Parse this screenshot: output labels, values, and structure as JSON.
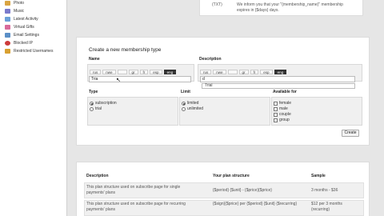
{
  "sidebar": {
    "items": [
      {
        "label": "Photo",
        "icon": "photo-icon",
        "color": "#d9a441"
      },
      {
        "label": "Music",
        "icon": "music-icon",
        "color": "#7a7acc"
      },
      {
        "label": "Latest Activity",
        "icon": "activity-icon",
        "color": "#6aa0d8"
      },
      {
        "label": "Virtual Gifts",
        "icon": "gift-icon",
        "color": "#d86a9a"
      },
      {
        "label": "Email Settings",
        "icon": "email-icon",
        "color": "#5b8fc7"
      },
      {
        "label": "Blocked IP",
        "icon": "blocked-icon",
        "color": "#cc3b3b"
      },
      {
        "label": "Restricted Usernames",
        "icon": "restricted-icon",
        "color": "#d8a030"
      }
    ]
  },
  "top_panel": {
    "code": "(TXT)",
    "note": "We inform you that your \"{membership_name}\" membership expires in {$days} days."
  },
  "form": {
    "heading": "Create a new membership type",
    "name_label": "Name",
    "description_label": "Description",
    "languages": [
      "rus",
      "nwe",
      "",
      "gr",
      "fr",
      "esp",
      "eng"
    ],
    "active_language": "eng",
    "name_value": "Tria",
    "description_value": "d",
    "dropdown_value": "Trial",
    "type_label": "Type",
    "limit_label": "Limit",
    "available_label": "Available for",
    "type_options": [
      {
        "label": "subscription",
        "selected": true
      },
      {
        "label": "trial",
        "selected": false
      }
    ],
    "limit_options": [
      {
        "label": "limited",
        "selected": true
      },
      {
        "label": "unlimited",
        "selected": false
      }
    ],
    "available_options": [
      {
        "label": "female",
        "checked": false
      },
      {
        "label": "male",
        "checked": false
      },
      {
        "label": "couple",
        "checked": false
      },
      {
        "label": "group",
        "checked": false
      }
    ],
    "create_label": "Create"
  },
  "plan_table": {
    "headers": [
      "Description",
      "Your plan structure",
      "Sample"
    ],
    "rows": [
      [
        "This plan structure used on subscribe page for single payments' plans",
        "{$period} {$unit} - {$price}{$price}",
        "3 months - $36"
      ],
      [
        "This plan structure used on subscribe page for recurring payments' plans",
        "{$sign}{$price} per {$period} {$unit} {$recurring}",
        "$12 per 3 months (recurring)"
      ]
    ]
  }
}
